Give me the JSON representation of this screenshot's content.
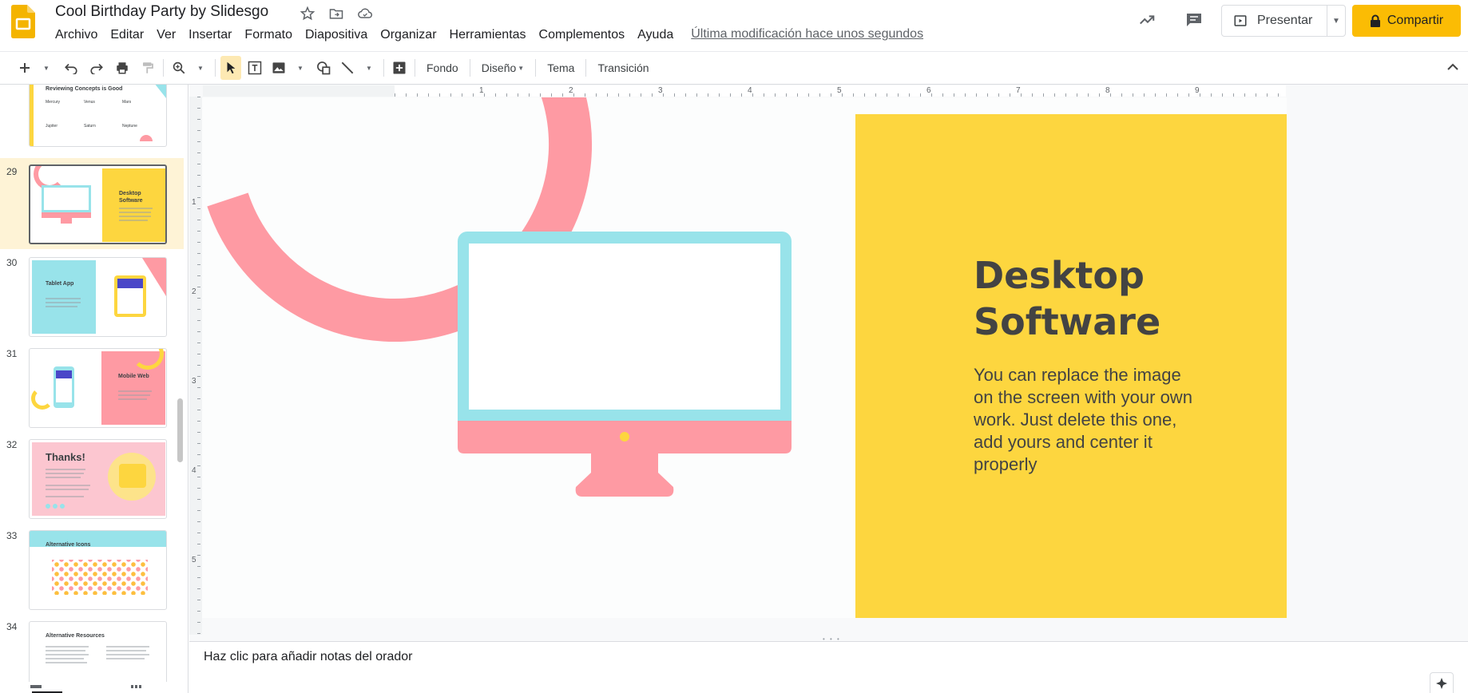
{
  "header": {
    "title": "Cool Birthday Party by Slidesgo",
    "icons": [
      "star-icon",
      "move-folder-icon",
      "cloud-saved-icon"
    ],
    "menu": [
      "Archivo",
      "Editar",
      "Ver",
      "Insertar",
      "Formato",
      "Diapositiva",
      "Organizar",
      "Herramientas",
      "Complementos",
      "Ayuda"
    ],
    "last_modified": "Última modificación hace unos segundos",
    "present_label": "Presentar",
    "share_label": "Compartir"
  },
  "toolbar": {
    "fondo": "Fondo",
    "diseno": "Diseño",
    "tema": "Tema",
    "transicion": "Transición"
  },
  "filmstrip": {
    "selected": 29,
    "slides": [
      {
        "number": "",
        "title": "Reviewing Concepts is Good",
        "labels": [
          "Mercury",
          "Venus",
          "Mars",
          "Jupiter",
          "Saturn",
          "Neptune"
        ]
      },
      {
        "number": "29",
        "title": "Desktop Software"
      },
      {
        "number": "30",
        "title": "Tablet App"
      },
      {
        "number": "31",
        "title": "Mobile Web"
      },
      {
        "number": "32",
        "title": "Thanks!"
      },
      {
        "number": "33",
        "title": "Alternative Icons"
      },
      {
        "number": "34",
        "title": "Alternative Resources"
      }
    ]
  },
  "rulers": {
    "top": [
      "1",
      "2",
      "3",
      "4",
      "5",
      "6",
      "7",
      "8",
      "9"
    ],
    "left": [
      "1",
      "2",
      "3",
      "4",
      "5"
    ]
  },
  "slide": {
    "title_line1": "Desktop",
    "title_line2": "Software",
    "body": "You can replace the image on the screen with your own work. Just delete this one, add yours and center it properly",
    "colors": {
      "yellow": "#fdd63f",
      "pink": "#fe9aa3",
      "cyan": "#98e3ea",
      "text": "#434343"
    }
  },
  "notes": {
    "placeholder": "Haz clic para añadir notas del orador"
  },
  "colors": {
    "brand_yellow": "#fbbc04",
    "selected_slide_bg": "#fef3d6"
  }
}
